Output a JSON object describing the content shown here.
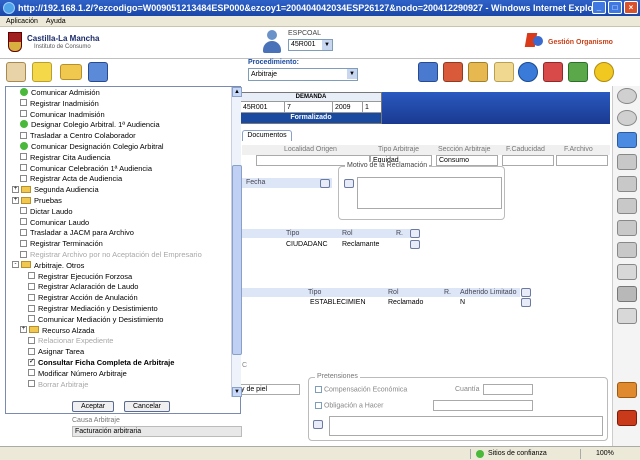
{
  "browser": {
    "title": "http://192.168.1.2/?ezcodigo=W009051213484ESP000&ezcoy1=200404042034ESP26127&nodo=200412290927 - Windows Internet Explorer",
    "menu": [
      "Aplicación",
      "Ayuda"
    ],
    "status_zone": "Sitios de confianza",
    "zoom": "100%"
  },
  "header": {
    "logo_title": "Castilla-La Mancha",
    "logo_subtitle": "Instituto de Consumo",
    "espcoal_label": "ESPCOAL",
    "espcoal_value": "45R001",
    "gestion_label": "Gestión Organismo"
  },
  "toolbar": {
    "procedimiento_label": "Procedimiento:",
    "procedimiento_value": "Arbitraje"
  },
  "demanda": {
    "title": "DEMANDA",
    "cells": [
      "45R001",
      "7",
      "2009",
      "1"
    ],
    "status": "Formalizado"
  },
  "documentos_tab": "Documentos",
  "sections": {
    "headers": [
      "Localidad Origen",
      "Tipo Arbitraje",
      "Sección Arbitraje",
      "F.Caducidad",
      "F.Archivo"
    ],
    "tipo_arbitraje": "Equidad",
    "seccion_arbitraje": "Consumo",
    "fecha_label": "Fecha",
    "motivo_label": "Motivo de la Reclamación",
    "grid1": {
      "headers": [
        "Tipo",
        "Rol",
        "R."
      ],
      "row": [
        "CIUDADANC",
        "Reclamante"
      ]
    },
    "grid2": {
      "headers": [
        "Tipo",
        "Rol",
        "R.",
        "Adherido",
        "Limitado"
      ],
      "row": [
        "ESTABLECIMIEN",
        "Reclamado",
        "N"
      ]
    },
    "pretensiones_label": "Pretensiones",
    "compensacion_label": "Compensación Económica",
    "cuantia_label": "Cuantía",
    "obligacion_label": "Obligación a Hacer",
    "partial_label": "y de piel",
    "partial_c": "C",
    "causa_label": "Causa Arbitraje",
    "causa_value": "Facturación arbitraria"
  },
  "popup": {
    "items": [
      {
        "label": "Comunicar Admisión",
        "type": "green",
        "indent": 1
      },
      {
        "label": "Registrar Inadmisión",
        "type": "box",
        "indent": 1
      },
      {
        "label": "Comunicar Inadmisión",
        "type": "box",
        "indent": 1
      },
      {
        "label": "Designar Colegio Arbitral. 1ª Audiencia",
        "type": "green",
        "indent": 1
      },
      {
        "label": "Trasladar a Centro Colaborador",
        "type": "box",
        "indent": 1
      },
      {
        "label": "Comunicar Designación Colegio Arbitral",
        "type": "green",
        "indent": 1
      },
      {
        "label": "Registrar Cita Audiencia",
        "type": "box",
        "indent": 1
      },
      {
        "label": "Comunicar Celebración 1ª Audiencia",
        "type": "box",
        "indent": 1
      },
      {
        "label": "Registrar Acta de Audiencia",
        "type": "box",
        "indent": 1
      },
      {
        "label": "Segunda Audiencia",
        "type": "folder",
        "pm": "+",
        "indent": 0
      },
      {
        "label": "Pruebas",
        "type": "folder",
        "pm": "+",
        "indent": 0
      },
      {
        "label": "Dictar Laudo",
        "type": "box",
        "indent": 1
      },
      {
        "label": "Comunicar Laudo",
        "type": "box",
        "indent": 1
      },
      {
        "label": "Trasladar a JACM para Archivo",
        "type": "box",
        "indent": 1
      },
      {
        "label": "Registrar Terminación",
        "type": "box",
        "indent": 1
      },
      {
        "label": "Registrar Archivo por no Aceptación del Empresario",
        "type": "box",
        "indent": 1,
        "disabled": true
      },
      {
        "label": "Arbitraje. Otros",
        "type": "folder",
        "pm": "-",
        "indent": 0
      },
      {
        "label": "Registrar Ejecución Forzosa",
        "type": "box",
        "indent": 2
      },
      {
        "label": "Registrar Aclaración de Laudo",
        "type": "box",
        "indent": 2
      },
      {
        "label": "Registrar Acción de Anulación",
        "type": "box",
        "indent": 2
      },
      {
        "label": "Registrar Mediación y Desistimiento",
        "type": "box",
        "indent": 2
      },
      {
        "label": "Comunicar Mediación y Desistimiento",
        "type": "box",
        "indent": 2
      },
      {
        "label": "Recurso Alzada",
        "type": "folder",
        "pm": "+",
        "indent": 1
      },
      {
        "label": "Relacionar Expediente",
        "type": "box",
        "indent": 2,
        "disabled": true
      },
      {
        "label": "Asignar Tarea",
        "type": "box",
        "indent": 2
      },
      {
        "label": "Consultar Ficha Completa de Arbitraje",
        "type": "checked",
        "indent": 2,
        "bold": true
      },
      {
        "label": "Modificar Número Arbitraje",
        "type": "box",
        "indent": 2
      },
      {
        "label": "Borrar Arbitraje",
        "type": "box",
        "indent": 2,
        "disabled": true
      }
    ],
    "accept_label": "Aceptar",
    "cancel_label": "Cancelar"
  },
  "colors": {
    "titlebar": "#1a47a8",
    "accent_blue": "#1a4aa0",
    "popup_border": "#7a8ab0",
    "gestion": "#c8421a"
  }
}
